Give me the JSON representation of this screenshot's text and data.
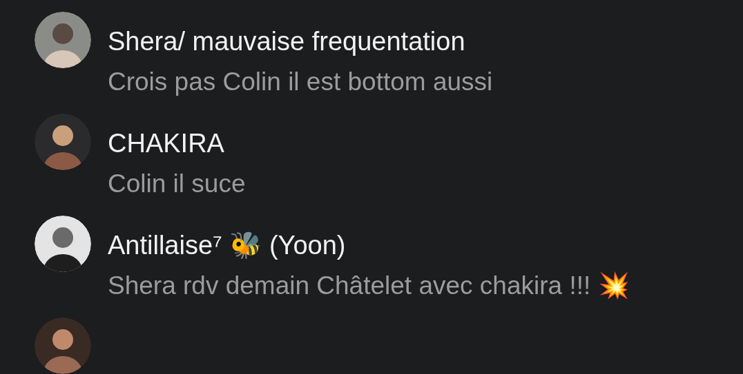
{
  "conversations": [
    {
      "name": "Shera/ mauvaise frequentation",
      "text": "Crois pas Colin il est bottom aussi",
      "avatar": {
        "kind": "picture"
      }
    },
    {
      "name": "CHAKIRA",
      "text": "Colin il suce",
      "avatar": {
        "kind": "picture"
      }
    },
    {
      "name": "Antillaise⁷ 🐝 (Yoon)",
      "text": "Shera rdv demain Châtelet avec chakira !!! 💥",
      "avatar": {
        "kind": "picture"
      }
    },
    {
      "avatar": {
        "kind": "picture"
      }
    }
  ]
}
